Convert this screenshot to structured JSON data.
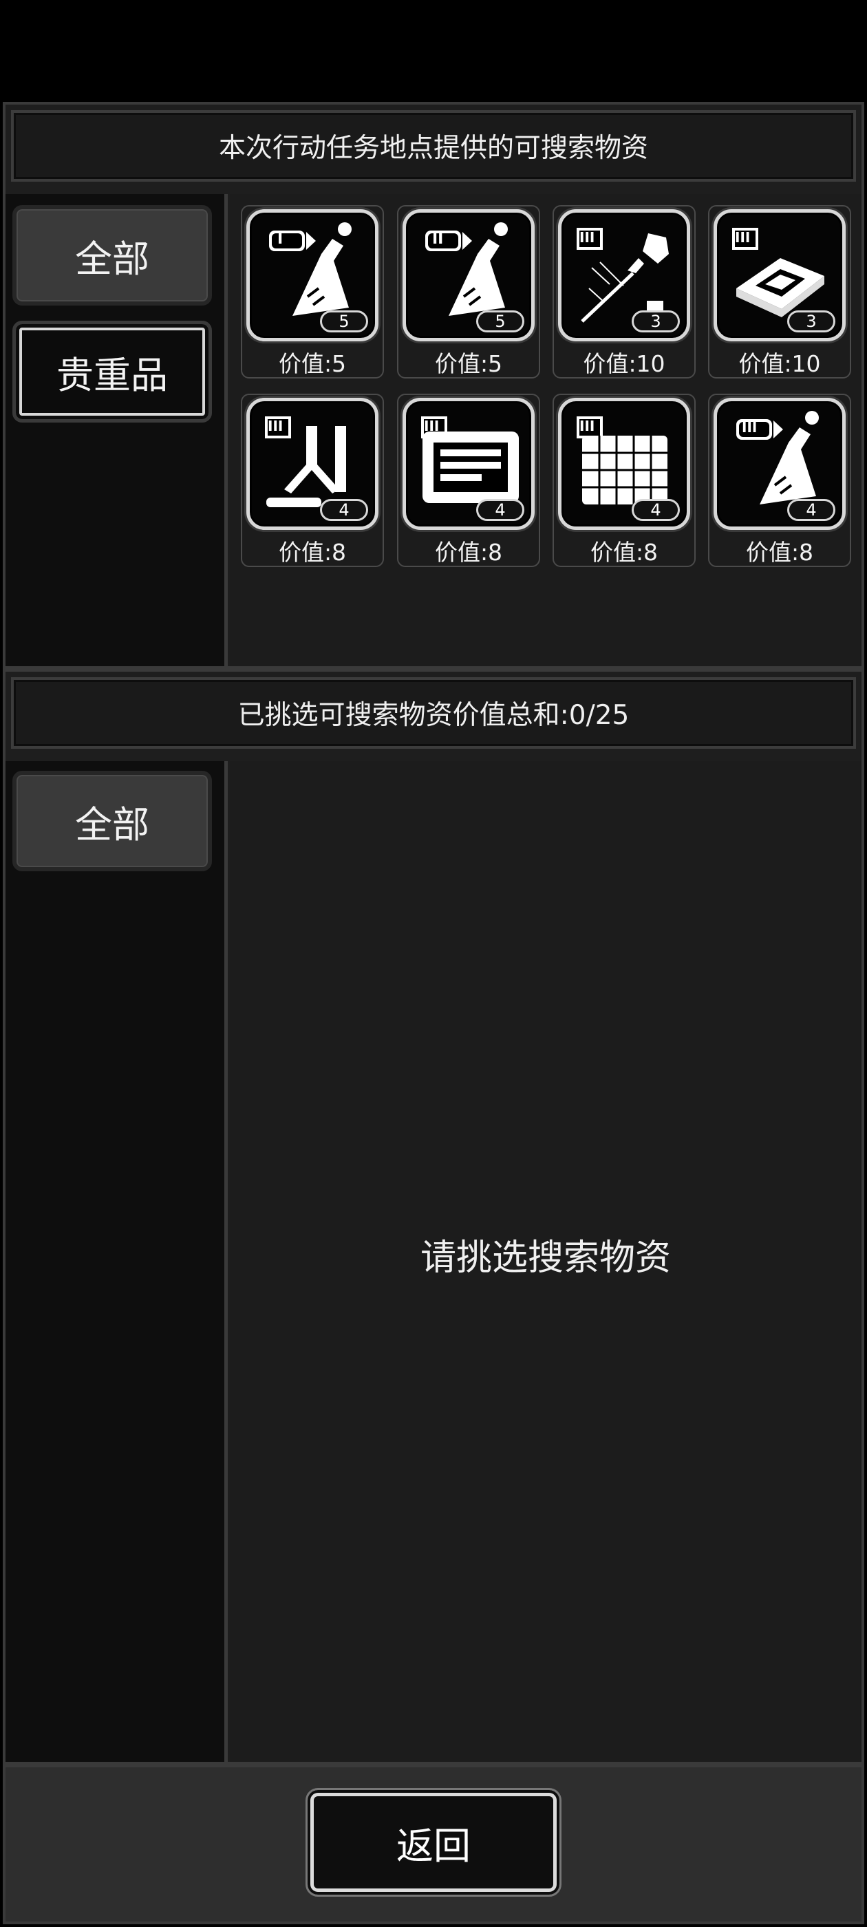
{
  "top_panel": {
    "title": "本次行动任务地点提供的可搜索物资",
    "tabs": [
      {
        "label": "全部",
        "active": true
      },
      {
        "label": "贵重品",
        "active": false
      }
    ],
    "items": [
      {
        "icon": "flask-icon",
        "tier": "I",
        "quantity": "5",
        "value_label": "价值:5"
      },
      {
        "icon": "flask-icon",
        "tier": "II",
        "quantity": "5",
        "value_label": "价值:5"
      },
      {
        "icon": "probe-icon",
        "tier": "III",
        "quantity": "3",
        "value_label": "价值:10"
      },
      {
        "icon": "chip-icon",
        "tier": "III",
        "quantity": "3",
        "value_label": "价值:10"
      },
      {
        "icon": "lab-equipment-icon",
        "tier": "III",
        "quantity": "4",
        "value_label": "价值:8"
      },
      {
        "icon": "machine-icon",
        "tier": "III",
        "quantity": "4",
        "value_label": "价值:8"
      },
      {
        "icon": "grid-panel-icon",
        "tier": "III",
        "quantity": "4",
        "value_label": "价值:8"
      },
      {
        "icon": "flask-icon",
        "tier": "III",
        "quantity": "4",
        "value_label": "价值:8"
      }
    ]
  },
  "bottom_panel": {
    "title": "已挑选可搜索物资价值总和:0/25",
    "tabs": [
      {
        "label": "全部",
        "active": true
      }
    ],
    "empty_message": "请挑选搜索物资"
  },
  "footer": {
    "back_label": "返回"
  },
  "colors": {
    "background": "#000000",
    "panel": "#1e1e1e",
    "border": "#3a3a3a",
    "text": "#ffffff"
  }
}
